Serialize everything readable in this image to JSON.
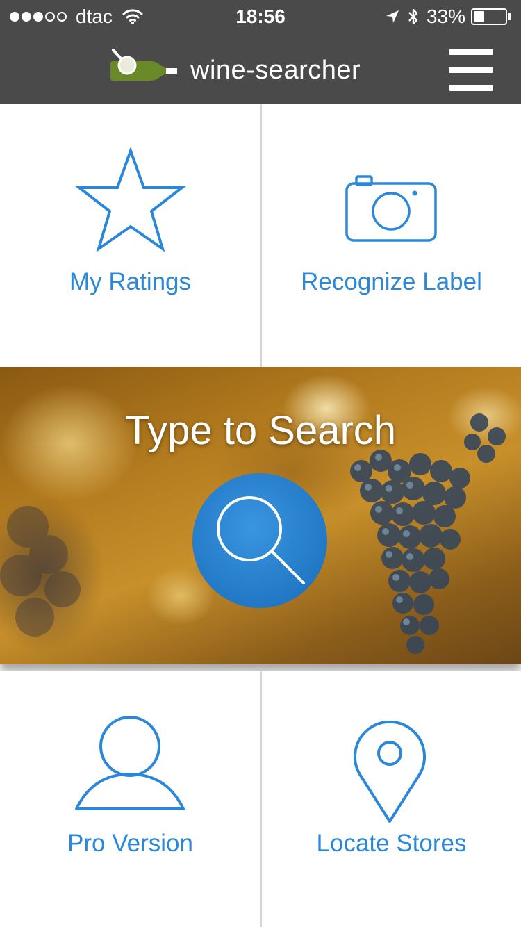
{
  "status_bar": {
    "carrier": "dtac",
    "time": "18:56",
    "battery": "33%",
    "battery_level": 0.33,
    "signal_bars_filled": 3,
    "signal_bars_total": 5
  },
  "header": {
    "brand": "wine-searcher",
    "logo_icon": "wine-bottle-magnifier-icon",
    "menu_icon": "hamburger-menu-icon"
  },
  "tiles": {
    "my_ratings": {
      "label": "My Ratings",
      "icon": "star-icon"
    },
    "recognize_label": {
      "label": "Recognize Label",
      "icon": "camera-icon"
    },
    "pro_version": {
      "label": "Pro Version",
      "icon": "user-icon"
    },
    "locate_stores": {
      "label": "Locate Stores",
      "icon": "location-pin-icon"
    }
  },
  "hero": {
    "title": "Type to Search",
    "button_icon": "search-icon"
  },
  "colors": {
    "accent": "#2b88d8",
    "header_bg": "#4a4a4a",
    "logo_green": "#6a8a2a",
    "divider": "#d4d4d4"
  }
}
